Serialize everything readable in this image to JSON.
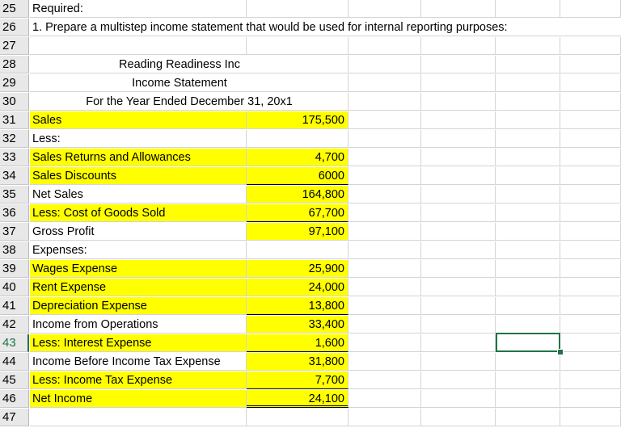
{
  "rows": [
    {
      "num": "25",
      "a": "Required:",
      "b": ""
    },
    {
      "num": "26",
      "a": "1. Prepare a multistep income statement that would be used for internal reporting purposes:",
      "b": ""
    },
    {
      "num": "27",
      "a": "",
      "b": ""
    },
    {
      "num": "28",
      "title": "Reading Readiness Inc"
    },
    {
      "num": "29",
      "title": "Income Statement"
    },
    {
      "num": "30",
      "title": "For the Year Ended December 31, 20x1"
    },
    {
      "num": "31",
      "a": "Sales",
      "b": "175,500"
    },
    {
      "num": "32",
      "a": "Less:",
      "b": ""
    },
    {
      "num": "33",
      "a": "Sales Returns and Allowances",
      "b": "4,700"
    },
    {
      "num": "34",
      "a": "Sales Discounts",
      "b": "6000"
    },
    {
      "num": "35",
      "a": "Net Sales",
      "b": "164,800"
    },
    {
      "num": "36",
      "a": "Less: Cost of Goods Sold",
      "b": "67,700"
    },
    {
      "num": "37",
      "a": "Gross Profit",
      "b": "97,100"
    },
    {
      "num": "38",
      "a": "Expenses:",
      "b": ""
    },
    {
      "num": "39",
      "a": "Wages Expense",
      "b": "25,900"
    },
    {
      "num": "40",
      "a": "Rent Expense",
      "b": "24,000"
    },
    {
      "num": "41",
      "a": "Depreciation Expense",
      "b": "13,800"
    },
    {
      "num": "42",
      "a": "Income from Operations",
      "b": "33,400"
    },
    {
      "num": "43",
      "a": "Less: Interest Expense",
      "b": "1,600"
    },
    {
      "num": "44",
      "a": "Income Before Income Tax Expense",
      "b": "31,800"
    },
    {
      "num": "45",
      "a": "Less: Income Tax Expense",
      "b": "7,700"
    },
    {
      "num": "46",
      "a": "Net Income",
      "b": "24,100"
    },
    {
      "num": "47",
      "a": "",
      "b": ""
    }
  ],
  "colors": {
    "highlight": "#ffff00",
    "selection": "#217346"
  }
}
